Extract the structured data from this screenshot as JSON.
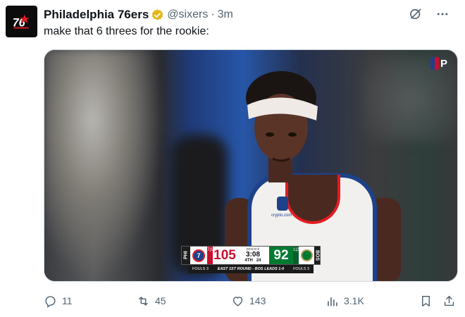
{
  "tweet": {
    "author_name": "Philadelphia 76ers",
    "handle": "@sixers",
    "separator": "·",
    "time": "3m",
    "text": "make that 6 threes for the rookie:"
  },
  "media": {
    "broadcast_bug": "P",
    "jersey_text": "crypto.com",
    "scorebug": {
      "home_label": "PHI",
      "home_logo": "7",
      "home_timeouts": "7|1",
      "home_score": "105",
      "network": "peacock",
      "clock": "3:08",
      "quarter": "4TH",
      "shot_clock": "24",
      "away_score": "92",
      "away_timeouts": "1|2",
      "away_label": "BOS",
      "home_fouls": "FOULS 3",
      "series": "EAST 1ST ROUND - BOS LEADS 1-0",
      "away_fouls": "FOULS 3"
    }
  },
  "actions": {
    "replies": "11",
    "reposts": "45",
    "likes": "143",
    "views": "3.1K"
  },
  "colors": {
    "text_primary": "#0f1419",
    "text_secondary": "#536471",
    "sixers_blue": "#1d428a",
    "sixers_red": "#c8102e",
    "celtics_green": "#007a33",
    "verified_gold": "#e2b719"
  },
  "icons": [
    "sixers-logo-icon",
    "verified-gold-icon",
    "grok-icon",
    "more-icon",
    "reply-icon",
    "repost-icon",
    "like-icon",
    "views-icon",
    "bookmark-icon",
    "share-icon"
  ]
}
